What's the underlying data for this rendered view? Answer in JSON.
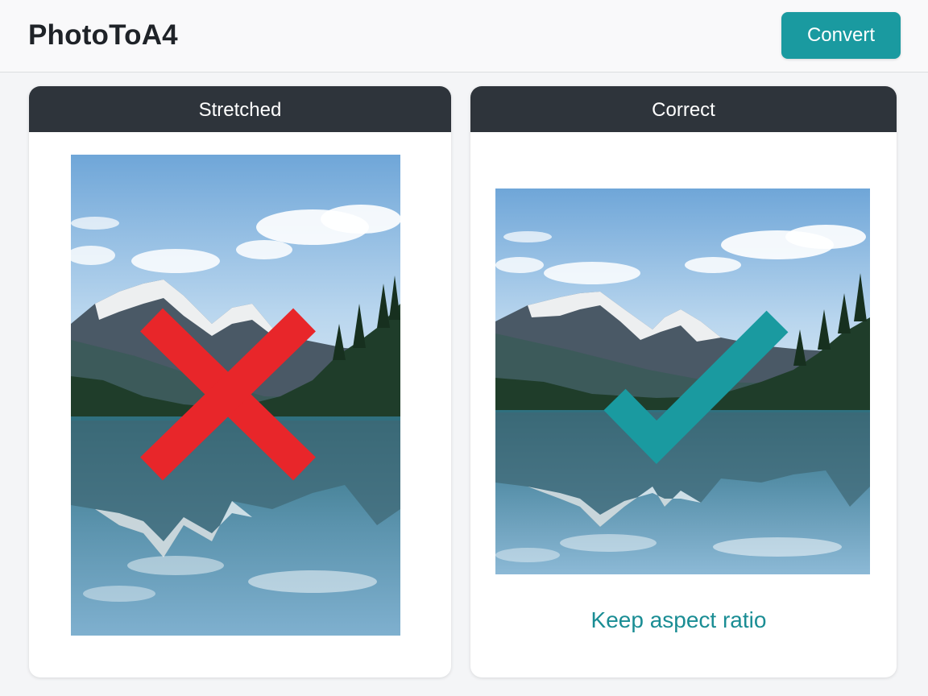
{
  "header": {
    "app_title": "PhotoToA4",
    "convert_label": "Convert"
  },
  "panels": {
    "left": {
      "title": "Stretched",
      "photo_description_icon": "mountain-lake-photo",
      "overlay_icon": "cross-mark-icon",
      "overlay_color": "#e8262a"
    },
    "right": {
      "title": "Correct",
      "photo_description_icon": "mountain-lake-photo",
      "overlay_icon": "check-mark-icon",
      "overlay_color": "#1a9aa0",
      "caption": "Keep aspect ratio"
    }
  },
  "colors": {
    "accent": "#1a9aa0",
    "header_bg": "#2e343b",
    "error": "#e8262a"
  }
}
